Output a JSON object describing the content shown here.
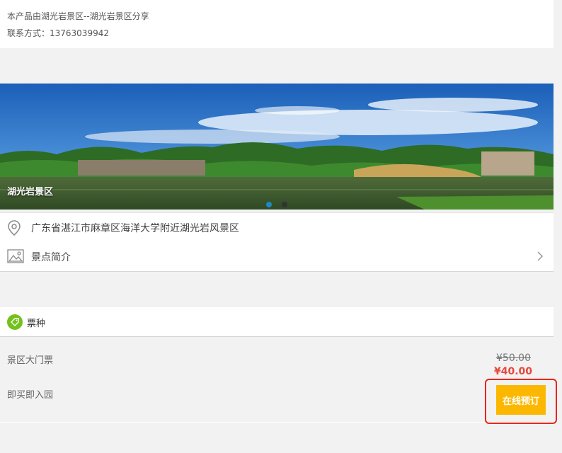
{
  "provider": {
    "line1": "本产品由湖光岩景区--湖光岩景区分享",
    "contact": "联系方式：13763039942"
  },
  "banner": {
    "title": "湖光岩景区",
    "image_icon": "landscape-photo"
  },
  "info": {
    "address": "广东省湛江市麻章区海洋大学附近湖光岩风景区",
    "address_icon": "location-pin-icon",
    "intro_label": "景点简介",
    "intro_icon": "image-icon"
  },
  "ticket": {
    "section_label": "票种",
    "tag_icon": "tag-icon",
    "name": "景区大门票",
    "note": "即买即入园",
    "original_price": "¥50.00",
    "price": "¥40.00",
    "book_label": "在线预订"
  },
  "colors": {
    "accent_green": "#74c11b",
    "price_red": "#e8483c",
    "button_yellow": "#fcb800",
    "highlight_red": "#e8261a",
    "dot_active": "#1e88c7"
  }
}
